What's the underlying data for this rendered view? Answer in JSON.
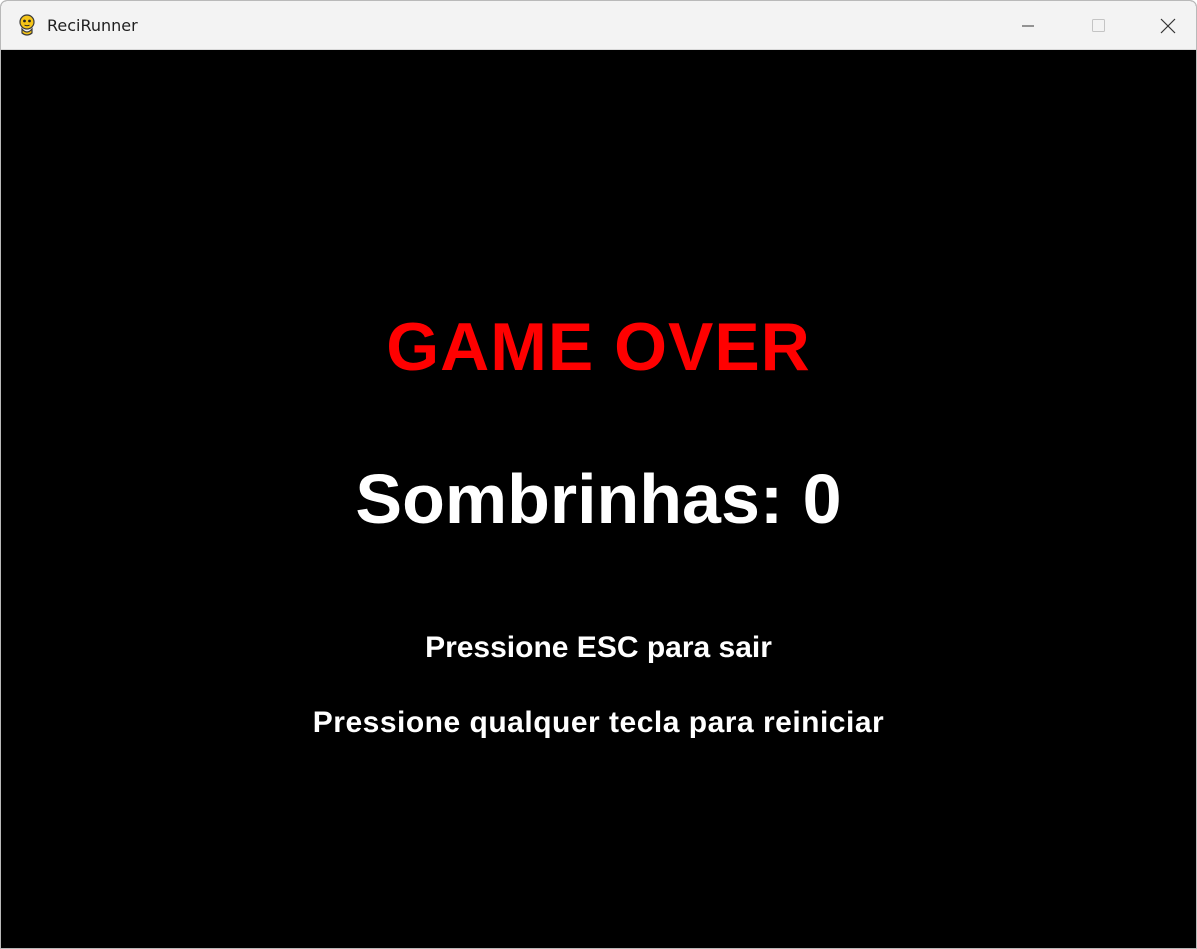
{
  "window": {
    "title": "ReciRunner",
    "icon": "pygame-snake-icon",
    "controls": {
      "minimize_icon": "minimize-icon",
      "maximize_icon": "maximize-icon",
      "close_icon": "close-icon"
    }
  },
  "game": {
    "background_color": "#000000",
    "game_over_text": "GAME OVER",
    "game_over_color": "#ff0000",
    "score_text": "Sombrinhas: 0",
    "hint_exit": "Pressione ESC para sair",
    "hint_restart": "Pressione qualquer tecla para reiniciar",
    "text_color": "#ffffff"
  }
}
